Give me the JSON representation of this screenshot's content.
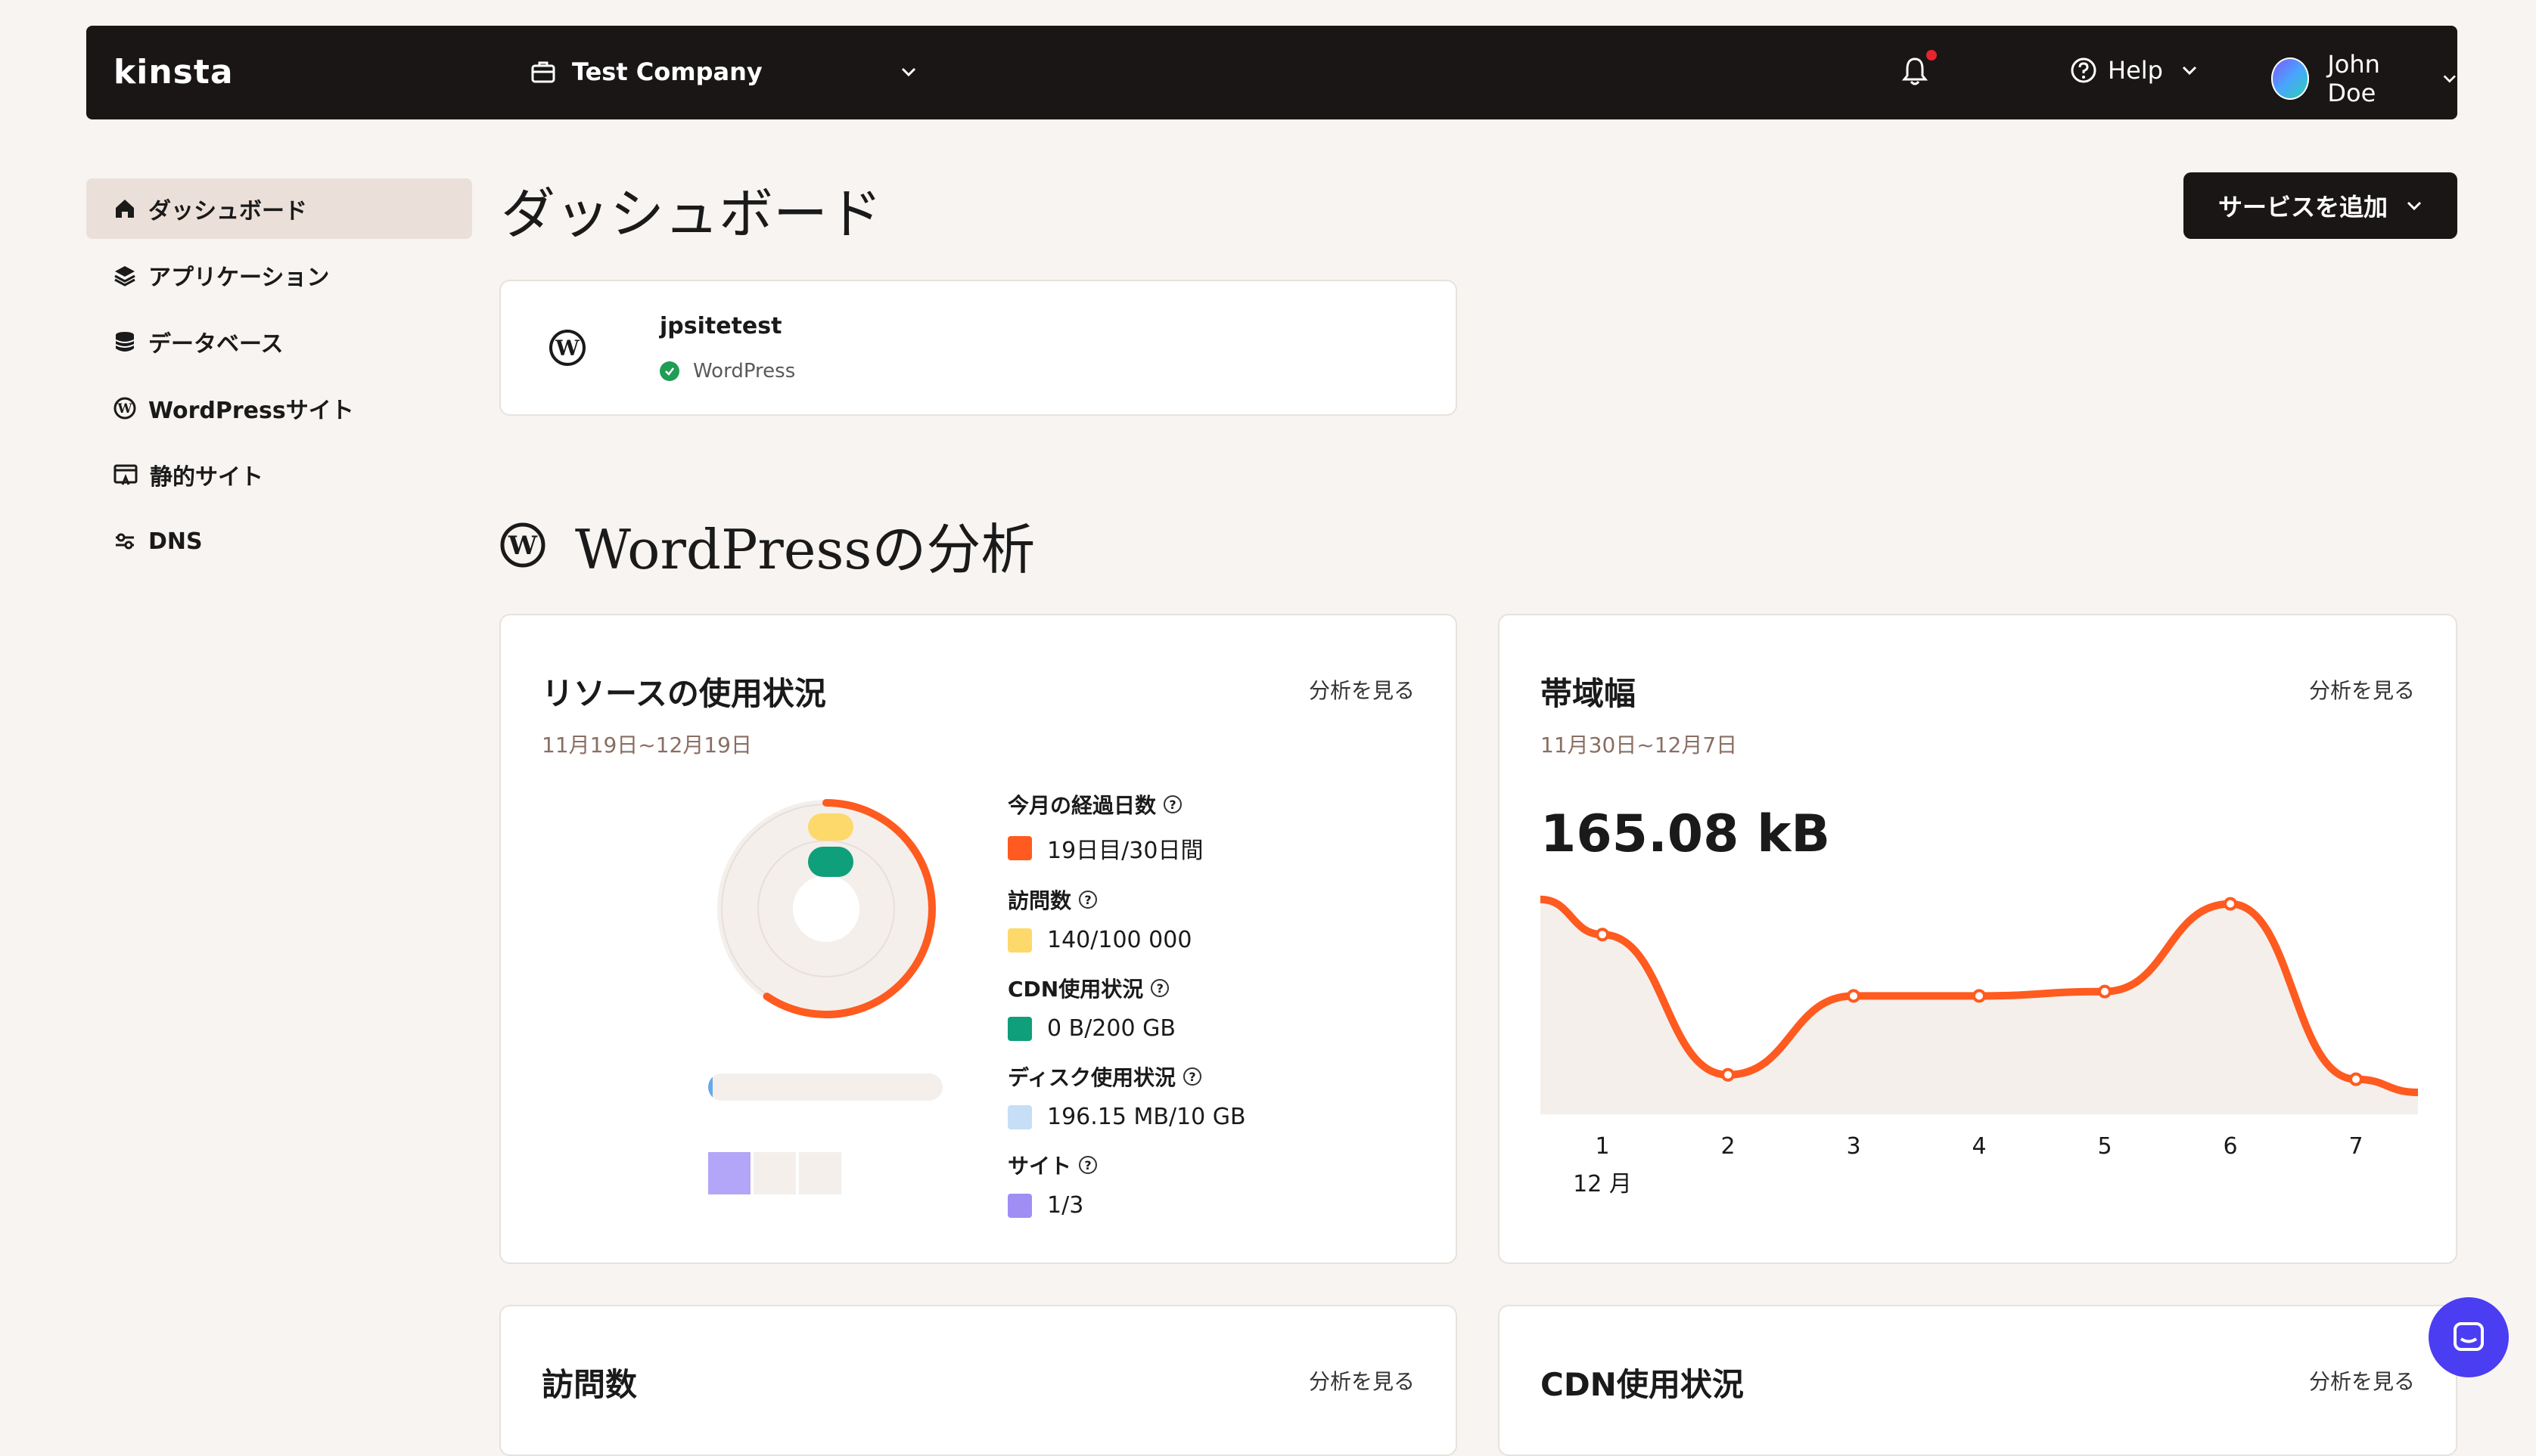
{
  "topbar": {
    "logo": "kinsta",
    "company": "Test Company",
    "help": "Help",
    "user": "John Doe"
  },
  "sidebar": {
    "items": [
      {
        "label": "ダッシュボード",
        "icon": "home-icon",
        "active": true
      },
      {
        "label": "アプリケーション",
        "icon": "layers-icon",
        "active": false
      },
      {
        "label": "データベース",
        "icon": "database-icon",
        "active": false
      },
      {
        "label": "WordPressサイト",
        "icon": "wordpress-icon",
        "active": false
      },
      {
        "label": "静的サイト",
        "icon": "static-site-icon",
        "active": false
      },
      {
        "label": "DNS",
        "icon": "dns-icon",
        "active": false
      }
    ]
  },
  "main": {
    "title": "ダッシュボード",
    "add_service": "サービスを追加",
    "site": {
      "name": "jpsitetest",
      "type": "WordPress"
    },
    "analytics_title": "WordPressの分析"
  },
  "resource_card": {
    "title": "リソースの使用状況",
    "link": "分析を見る",
    "date": "11月19日~12月19日",
    "legend": [
      {
        "label": "今月の経過日数",
        "value": "19日目/30日間",
        "color": "#ff5a1f",
        "fraction": 0.633
      },
      {
        "label": "訪問数",
        "value": "140/100 000",
        "color": "#fcd96a",
        "fraction": 0.0014
      },
      {
        "label": "CDN使用状況",
        "value": "0 B/200 GB",
        "color": "#0f9f7a",
        "fraction": 0
      },
      {
        "label": "ディスク使用状況",
        "value": "196.15 MB/10 GB",
        "color": "#c6def6",
        "fraction": 0.0196
      },
      {
        "label": "サイト",
        "value": "1/3",
        "color": "#a18ef5",
        "fraction": 0.333
      }
    ]
  },
  "bandwidth_card": {
    "title": "帯域幅",
    "link": "分析を見る",
    "date": "11月30日~12月7日",
    "total": "165.08 kB"
  },
  "visits_card": {
    "title": "訪問数",
    "link": "分析を見る"
  },
  "cdn_card": {
    "title": "CDN使用状況",
    "link": "分析を見る"
  },
  "chart_data": {
    "type": "area",
    "title": "帯域幅",
    "x": [
      "1",
      "2",
      "3",
      "4",
      "5",
      "6",
      "7"
    ],
    "x_sublabel": "12 月",
    "values": [
      0.82,
      0.18,
      0.54,
      0.54,
      0.56,
      0.96,
      0.16
    ],
    "color": "#ff5a1f",
    "fill": "#f4efeb"
  }
}
